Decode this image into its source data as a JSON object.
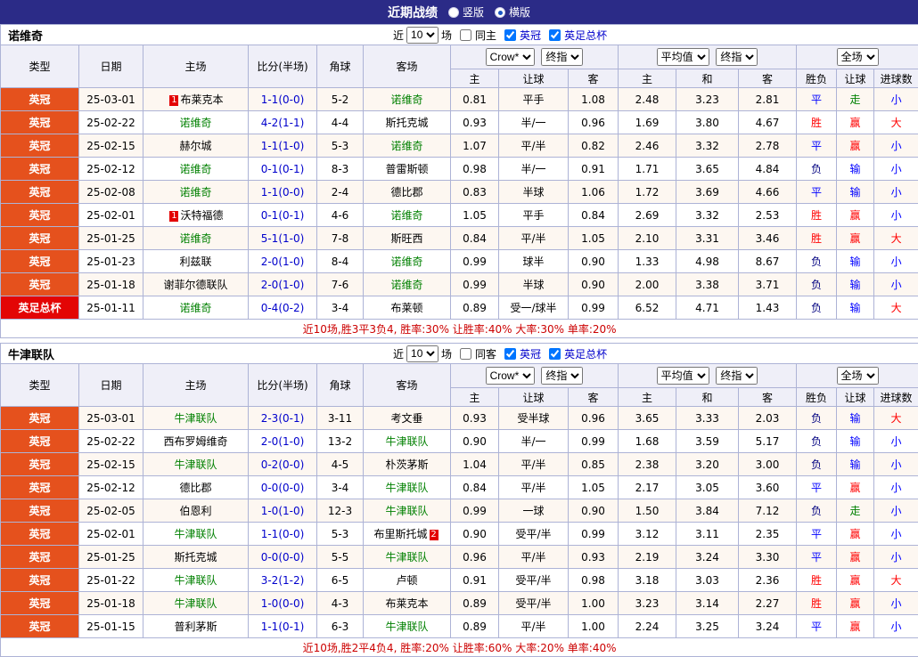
{
  "top_bar": {
    "title": "近期战绩",
    "options": [
      {
        "label": "竖版",
        "selected": false
      },
      {
        "label": "横版",
        "selected": true
      }
    ]
  },
  "header_labels": {
    "type": "类型",
    "date": "日期",
    "home": "主场",
    "score": "比分(半场)",
    "corners": "角球",
    "away": "客场",
    "odds_group": {
      "select1": "Crow*",
      "select2": "终指",
      "sub": [
        "主",
        "让球",
        "客"
      ]
    },
    "avg_group": {
      "select1": "平均值",
      "select2": "终指",
      "sub": [
        "主",
        "和",
        "客"
      ]
    },
    "full_group": {
      "select1": "全场",
      "sub": [
        "胜负",
        "让球",
        "进球数"
      ]
    }
  },
  "filter_labels": {
    "near": "近",
    "games_value": "10",
    "games_suffix": "场",
    "league1": "英冠",
    "league2": "英足总杯"
  },
  "filter_state": {
    "same_checked": false,
    "league1_checked": true,
    "league2_checked": true
  },
  "colors": {
    "topbar_bg": "#2b2b87",
    "league_champ_bg": "#e5511d",
    "league_facup_bg": "#e30505",
    "focus_team": "#008000",
    "score": "#0000cc",
    "win": "#ff0000",
    "draw": "#0000ff",
    "loss": "#000080",
    "cover": "#ff0000",
    "push": "#008000",
    "lose": "#0000ff",
    "over": "#ff0000",
    "under": "#0000ff",
    "summary": "#cc0000"
  },
  "sections": [
    {
      "team": "诺维奇",
      "same_label": "同主",
      "summary": "近10场,胜3平3负4, 胜率:30% 让胜率:40% 大率:30% 单率:20%",
      "rows": [
        {
          "league": "英冠",
          "date": "25-03-01",
          "home": "布莱克本",
          "home_badge": "1",
          "away": "诺维奇",
          "score": "1-1(0-0)",
          "corners": "5-2",
          "o1": "0.81",
          "hcap": "平手",
          "o2": "1.08",
          "h": "2.48",
          "d": "3.23",
          "a": "2.81",
          "r1": "平",
          "r2": "走",
          "r3": "小"
        },
        {
          "league": "英冠",
          "date": "25-02-22",
          "home": "诺维奇",
          "away": "斯托克城",
          "score": "4-2(1-1)",
          "corners": "4-4",
          "o1": "0.93",
          "hcap": "半/一",
          "o2": "0.96",
          "h": "1.69",
          "d": "3.80",
          "a": "4.67",
          "r1": "胜",
          "r2": "赢",
          "r3": "大"
        },
        {
          "league": "英冠",
          "date": "25-02-15",
          "home": "赫尔城",
          "away": "诺维奇",
          "score": "1-1(1-0)",
          "corners": "5-3",
          "o1": "1.07",
          "hcap": "平/半",
          "o2": "0.82",
          "h": "2.46",
          "d": "3.32",
          "a": "2.78",
          "r1": "平",
          "r2": "赢",
          "r3": "小"
        },
        {
          "league": "英冠",
          "date": "25-02-12",
          "home": "诺维奇",
          "away": "普雷斯顿",
          "score": "0-1(0-1)",
          "corners": "8-3",
          "o1": "0.98",
          "hcap": "半/一",
          "o2": "0.91",
          "h": "1.71",
          "d": "3.65",
          "a": "4.84",
          "r1": "负",
          "r2": "输",
          "r3": "小"
        },
        {
          "league": "英冠",
          "date": "25-02-08",
          "home": "诺维奇",
          "away": "德比郡",
          "score": "1-1(0-0)",
          "corners": "2-4",
          "o1": "0.83",
          "hcap": "半球",
          "o2": "1.06",
          "h": "1.72",
          "d": "3.69",
          "a": "4.66",
          "r1": "平",
          "r2": "输",
          "r3": "小"
        },
        {
          "league": "英冠",
          "date": "25-02-01",
          "home": "沃特福德",
          "home_badge": "1",
          "away": "诺维奇",
          "score": "0-1(0-1)",
          "corners": "4-6",
          "o1": "1.05",
          "hcap": "平手",
          "o2": "0.84",
          "h": "2.69",
          "d": "3.32",
          "a": "2.53",
          "r1": "胜",
          "r2": "赢",
          "r3": "小"
        },
        {
          "league": "英冠",
          "date": "25-01-25",
          "home": "诺维奇",
          "away": "斯旺西",
          "score": "5-1(1-0)",
          "corners": "7-8",
          "o1": "0.84",
          "hcap": "平/半",
          "o2": "1.05",
          "h": "2.10",
          "d": "3.31",
          "a": "3.46",
          "r1": "胜",
          "r2": "赢",
          "r3": "大"
        },
        {
          "league": "英冠",
          "date": "25-01-23",
          "home": "利兹联",
          "away": "诺维奇",
          "score": "2-0(1-0)",
          "corners": "8-4",
          "o1": "0.99",
          "hcap": "球半",
          "o2": "0.90",
          "h": "1.33",
          "d": "4.98",
          "a": "8.67",
          "r1": "负",
          "r2": "输",
          "r3": "小"
        },
        {
          "league": "英冠",
          "date": "25-01-18",
          "home": "谢菲尔德联队",
          "away": "诺维奇",
          "score": "2-0(1-0)",
          "corners": "7-6",
          "o1": "0.99",
          "hcap": "半球",
          "o2": "0.90",
          "h": "2.00",
          "d": "3.38",
          "a": "3.71",
          "r1": "负",
          "r2": "输",
          "r3": "小"
        },
        {
          "league": "英足总杯",
          "date": "25-01-11",
          "home": "诺维奇",
          "away": "布莱顿",
          "score": "0-4(0-2)",
          "corners": "3-4",
          "o1": "0.89",
          "hcap": "受一/球半",
          "o2": "0.99",
          "h": "6.52",
          "d": "4.71",
          "a": "1.43",
          "r1": "负",
          "r2": "输",
          "r3": "大"
        }
      ]
    },
    {
      "team": "牛津联队",
      "same_label": "同客",
      "summary": "近10场,胜2平4负4, 胜率:20% 让胜率:60% 大率:20% 单率:40%",
      "rows": [
        {
          "league": "英冠",
          "date": "25-03-01",
          "home": "牛津联队",
          "away": "考文垂",
          "score": "2-3(0-1)",
          "corners": "3-11",
          "o1": "0.93",
          "hcap": "受半球",
          "o2": "0.96",
          "h": "3.65",
          "d": "3.33",
          "a": "2.03",
          "r1": "负",
          "r2": "输",
          "r3": "大"
        },
        {
          "league": "英冠",
          "date": "25-02-22",
          "home": "西布罗姆维奇",
          "away": "牛津联队",
          "score": "2-0(1-0)",
          "corners": "13-2",
          "o1": "0.90",
          "hcap": "半/一",
          "o2": "0.99",
          "h": "1.68",
          "d": "3.59",
          "a": "5.17",
          "r1": "负",
          "r2": "输",
          "r3": "小"
        },
        {
          "league": "英冠",
          "date": "25-02-15",
          "home": "牛津联队",
          "away": "朴茨茅斯",
          "score": "0-2(0-0)",
          "corners": "4-5",
          "o1": "1.04",
          "hcap": "平/半",
          "o2": "0.85",
          "h": "2.38",
          "d": "3.20",
          "a": "3.00",
          "r1": "负",
          "r2": "输",
          "r3": "小"
        },
        {
          "league": "英冠",
          "date": "25-02-12",
          "home": "德比郡",
          "away": "牛津联队",
          "score": "0-0(0-0)",
          "corners": "3-4",
          "o1": "0.84",
          "hcap": "平/半",
          "o2": "1.05",
          "h": "2.17",
          "d": "3.05",
          "a": "3.60",
          "r1": "平",
          "r2": "赢",
          "r3": "小"
        },
        {
          "league": "英冠",
          "date": "25-02-05",
          "home": "伯恩利",
          "away": "牛津联队",
          "score": "1-0(1-0)",
          "corners": "12-3",
          "o1": "0.99",
          "hcap": "一球",
          "o2": "0.90",
          "h": "1.50",
          "d": "3.84",
          "a": "7.12",
          "r1": "负",
          "r2": "走",
          "r3": "小"
        },
        {
          "league": "英冠",
          "date": "25-02-01",
          "home": "牛津联队",
          "away": "布里斯托城",
          "away_badge": "2",
          "score": "1-1(0-0)",
          "corners": "5-3",
          "o1": "0.90",
          "hcap": "受平/半",
          "o2": "0.99",
          "h": "3.12",
          "d": "3.11",
          "a": "2.35",
          "r1": "平",
          "r2": "赢",
          "r3": "小"
        },
        {
          "league": "英冠",
          "date": "25-01-25",
          "home": "斯托克城",
          "away": "牛津联队",
          "score": "0-0(0-0)",
          "corners": "5-5",
          "o1": "0.96",
          "hcap": "平/半",
          "o2": "0.93",
          "h": "2.19",
          "d": "3.24",
          "a": "3.30",
          "r1": "平",
          "r2": "赢",
          "r3": "小"
        },
        {
          "league": "英冠",
          "date": "25-01-22",
          "home": "牛津联队",
          "away": "卢顿",
          "score": "3-2(1-2)",
          "corners": "6-5",
          "o1": "0.91",
          "hcap": "受平/半",
          "o2": "0.98",
          "h": "3.18",
          "d": "3.03",
          "a": "2.36",
          "r1": "胜",
          "r2": "赢",
          "r3": "大"
        },
        {
          "league": "英冠",
          "date": "25-01-18",
          "home": "牛津联队",
          "away": "布莱克本",
          "score": "1-0(0-0)",
          "corners": "4-3",
          "o1": "0.89",
          "hcap": "受平/半",
          "o2": "1.00",
          "h": "3.23",
          "d": "3.14",
          "a": "2.27",
          "r1": "胜",
          "r2": "赢",
          "r3": "小"
        },
        {
          "league": "英冠",
          "date": "25-01-15",
          "home": "普利茅斯",
          "away": "牛津联队",
          "score": "1-1(0-1)",
          "corners": "6-3",
          "o1": "0.89",
          "hcap": "平/半",
          "o2": "1.00",
          "h": "2.24",
          "d": "3.25",
          "a": "3.24",
          "r1": "平",
          "r2": "赢",
          "r3": "小"
        }
      ]
    }
  ]
}
